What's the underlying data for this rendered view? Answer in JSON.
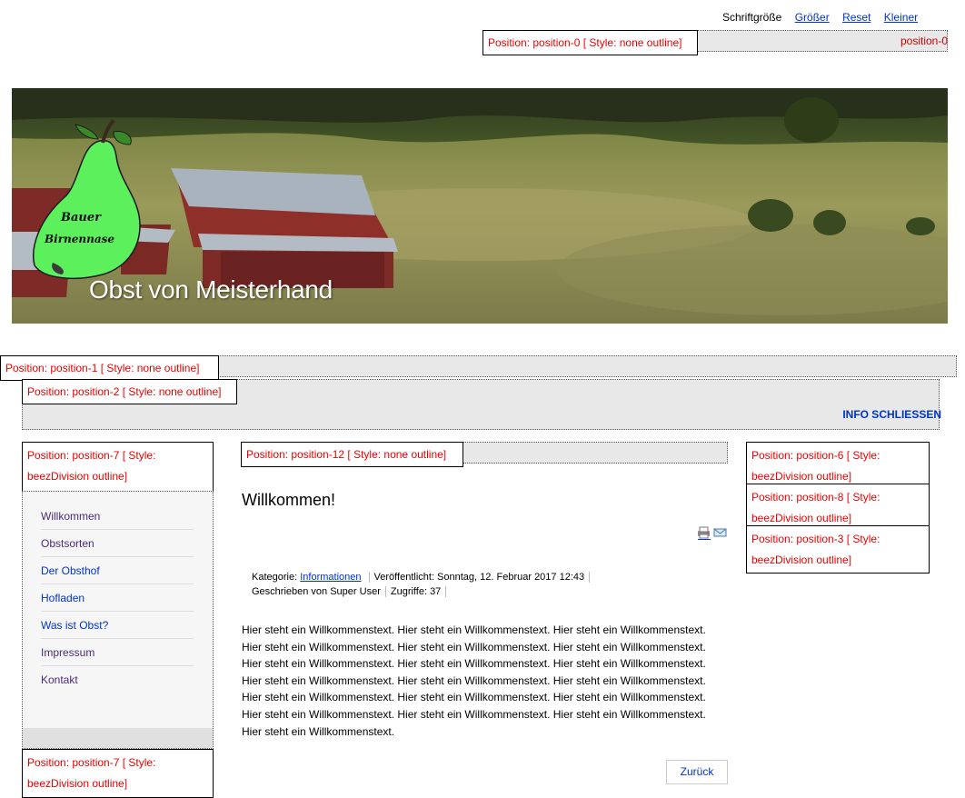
{
  "fontbar": {
    "label": "Schriftgröße",
    "bigger": "Größer",
    "reset": "Reset",
    "smaller": "Kleiner"
  },
  "position0": {
    "box": "Position: position-0 [ Style: none outline]",
    "right": "position-0"
  },
  "header": {
    "logo_line1": "Bauer",
    "logo_line2": "Birnennase",
    "title": "Obst von Meisterhand"
  },
  "position1": {
    "box": "Position: position-1 [ Style: none outline]"
  },
  "position2": {
    "box": "Position: position-2 [ Style: none outline]",
    "close": "INFO SCHLIESSEN"
  },
  "left": {
    "top_box": "Position: position-7 [ Style: beezDivision outline]",
    "menu": [
      "Willkommen",
      "Obstsorten",
      "Der Obsthof",
      "Hofladen",
      "Was ist Obst?",
      "Impressum",
      "Kontakt"
    ],
    "bottom_box": "Position: position-7 [ Style: beezDivision outline]"
  },
  "center": {
    "position_box": "Position: position-12 [ Style: none outline]",
    "title": "Willkommen!",
    "meta": {
      "category_label": "Kategorie:",
      "category": "Informationen",
      "published": "Veröffentlicht: Sonntag, 12. Februar 2017 12:43",
      "author": "Geschrieben von Super User",
      "hits": "Zugriffe: 37"
    },
    "body": "Hier steht ein Willkommenstext. Hier steht ein Willkommenstext. Hier steht ein Willkommenstext. Hier steht ein Willkommenstext. Hier steht ein Willkommenstext. Hier steht ein Willkommenstext. Hier steht ein Willkommenstext. Hier steht ein Willkommenstext. Hier steht ein Willkommenstext. Hier steht ein Willkommenstext. Hier steht ein Willkommenstext. Hier steht ein Willkommenstext. Hier steht ein Willkommenstext. Hier steht ein Willkommenstext. Hier steht ein Willkommenstext. Hier steht ein Willkommenstext. Hier steht ein Willkommenstext. Hier steht ein Willkommenstext. Hier steht ein Willkommenstext.",
    "back": "Zurück"
  },
  "right": {
    "boxes": [
      "Position: position-6 [ Style: beezDivision outline]",
      "Position: position-8 [ Style: beezDivision outline]",
      "Position: position-3 [ Style: beezDivision outline]"
    ]
  },
  "icons": [
    "print-icon",
    "email-icon"
  ],
  "colors": {
    "link": "#0033cc",
    "position_text": "#e00000",
    "pear_green": "#5cf05c",
    "menu_visited": "#4a2a7a"
  }
}
